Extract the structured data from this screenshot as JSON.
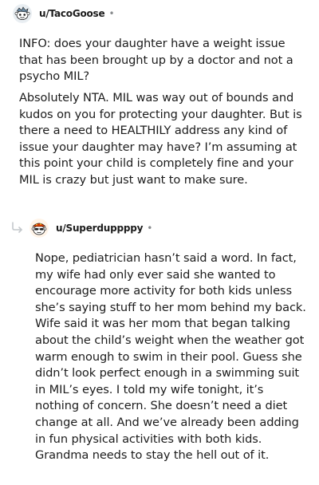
{
  "comments": [
    {
      "username": "u/TacoGoose",
      "avatar_icon": "snoo-avatar-icon",
      "paragraphs": [
        "INFO: does your daughter have a weight issue that has been brought up by a doctor and not a psycho MIL?",
        "Absolutely NTA. MIL was way out of bounds and kudos on you for protecting your daughter. But is there a need to HEALTHILY address any kind of issue your daughter may have? I’m assuming at this point your child is completely fine and your MIL is crazy but just want to make sure."
      ]
    },
    {
      "username": "u/Superduppppy",
      "avatar_icon": "snoo-avatar-icon",
      "reply_icon": "reply-arrow-icon",
      "paragraphs": [
        "Nope, pediatrician hasn’t said a word. In fact, my wife had only ever said she wanted to encourage more activity for both kids unless she’s saying stuff to her mom behind my back. Wife said it was her mom that began talking about the child’s weight when the weather got warm enough to swim in their pool. Guess she didn’t look perfect enough in a swimming suit in MIL’s eyes. I told my wife tonight, it’s nothing of concern. She doesn’t need a diet change at all. And we’ve already been adding in fun physical activities with both kids. Grandma needs to stay the hell out of it."
      ]
    }
  ],
  "separator": "•",
  "colors": {
    "text": "#1c1c1c",
    "meta": "#878a8c",
    "background": "#ffffff"
  }
}
